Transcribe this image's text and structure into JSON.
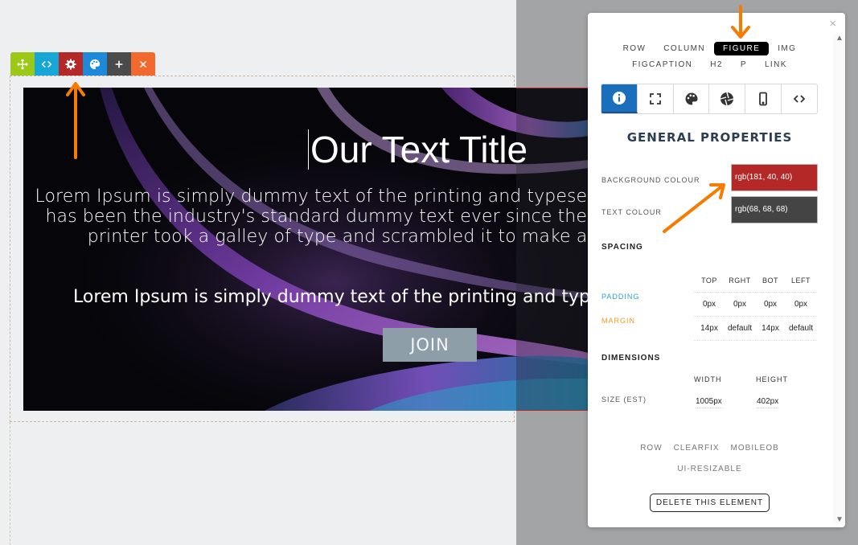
{
  "toolbar": {
    "buttons": [
      {
        "name": "move-button",
        "icon": "move-icon"
      },
      {
        "name": "code-button",
        "icon": "code-icon"
      },
      {
        "name": "settings-button",
        "icon": "gear-icon"
      },
      {
        "name": "style-button",
        "icon": "palette-icon"
      },
      {
        "name": "add-button",
        "icon": "plus-icon"
      },
      {
        "name": "remove-button",
        "icon": "close-icon"
      }
    ],
    "colors": {
      "move": "#9cc817",
      "code": "#16a7d6",
      "gear": "#b52828",
      "palette": "#1c8ad8",
      "add": "#4b4b4b",
      "close": "#f2692e"
    }
  },
  "hero": {
    "title": "Our Text Title",
    "paragraph1": "Lorem Ipsum is simply dummy text of the printing and typesetting industry. Lorem Ipsum has been the industry's standard dummy text ever since the 1500s, when an unknown printer took a galley of type and scrambled it to make a type specimen book.",
    "paragraph2": "Lorem Ipsum is simply dummy text of the printing and typesetting industry.",
    "button_label": "JOIN"
  },
  "panel": {
    "close_icon": "×",
    "element_tags_row1": [
      "ROW",
      "COLUMN",
      "FIGURE",
      "IMG"
    ],
    "element_tags_row2": [
      "FIGCAPTION",
      "H2",
      "P",
      "LINK"
    ],
    "active_tag": "FIGURE",
    "tabs": [
      {
        "name": "tab-info",
        "icon": "info-icon"
      },
      {
        "name": "tab-expand",
        "icon": "expand-icon"
      },
      {
        "name": "tab-palette",
        "icon": "palette-icon"
      },
      {
        "name": "tab-aperture",
        "icon": "aperture-icon"
      },
      {
        "name": "tab-mobile",
        "icon": "mobile-icon"
      },
      {
        "name": "tab-code",
        "icon": "code-icon"
      }
    ],
    "section_title": "GENERAL PROPERTIES",
    "background_colour_label": "BACKGROUND COLOUR",
    "background_colour_value": "rgb(181, 40, 40)",
    "background_colour_hex": "#b52828",
    "text_colour_label": "TEXT COLOUR",
    "text_colour_value": "rgb(68, 68, 68)",
    "text_colour_hex": "#444444",
    "spacing": {
      "heading": "SPACING",
      "columns": [
        "TOP",
        "RGHT",
        "BOT",
        "LEFT"
      ],
      "padding_label": "PADDING",
      "padding_values": [
        "0px",
        "0px",
        "0px",
        "0px"
      ],
      "margin_label": "MARGIN",
      "margin_values": [
        "14px",
        "default",
        "14px",
        "default"
      ]
    },
    "dimensions": {
      "heading": "DIMENSIONS",
      "width_label": "WIDTH",
      "height_label": "HEIGHT",
      "size_label": "SIZE (EST)",
      "width_value": "1005px",
      "height_value": "402px"
    },
    "classes_row1": [
      "ROW",
      "CLEARFIX",
      "MOBILEOB"
    ],
    "classes_row2": [
      "UI-RESIZABLE"
    ],
    "delete_label": "DELETE THIS ELEMENT"
  },
  "annotations": {
    "arrow_color": "#f57c00"
  }
}
